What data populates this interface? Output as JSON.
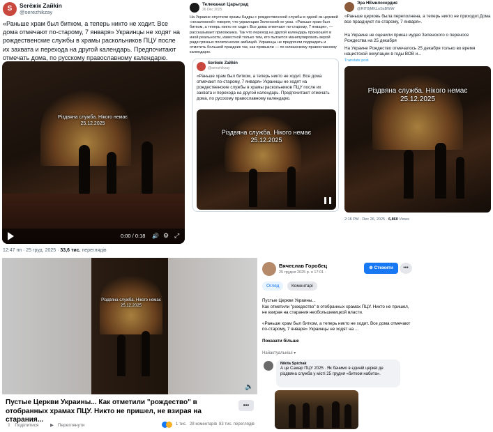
{
  "post1": {
    "avatar_initial": "S",
    "name": "Serёжік Zaйkin",
    "handle": "@serezhikzay",
    "text": "«Раньше храм был битком, а теперь никто не ходит. Все дома отмечают по-старому, 7 января» Украинцы не ходят на рождественские службы в храмы раскольников ПЦУ после их захвата и перехода на другой календарь. Предпочитают отмечать дома, по русскому православному календарю.",
    "video_caption_line1": "Різдвяна служба. Нікого немає",
    "video_caption_line2": "25.12.2025",
    "time": "0:00 / 0:18",
    "footer": "12:47 пп · 25 груд. 2025 ·",
    "views": "33,6 тис.",
    "views_label": "переглядів"
  },
  "post2": {
    "name": "Телеканал Царьград",
    "date": "26 Dec 2025",
    "text": "На Украине опустели храмы Кадры с рождественской службы в одной из церквей «незалежной» говорят, что украинцам Зеленский не указ. «Раньше храм был битком, а теперь никто не ходит. Все дома отмечают по-старому, 7 января», — рассказывает прихожанка. Так что переход на другой календарь произошёл в иной реальности, известной только тем, кто пытается манипулировать верой ради грязных политических амбиций. Украинцы не предпочли подождать и отметить большой праздник так, как привыкли — по юлианскому православному календарю.",
    "quote_name": "Serёжік Zaйkin",
    "quote_handle": "@serezhikzay",
    "quote_text": "«Раньше храм был битком, а теперь никто не ходит. Все дома отмечают по-старому, 7 января» Украинцы не ходят на рождественские службы в храмы раскольников ПЦУ после их захвата и перехода на другой календарь. Предпочитают отмечать дома, по русскому православному календарю.",
    "caption_line1": "Різдвяна служба. Нікого немає",
    "caption_line2": "25.12.2025"
  },
  "post3": {
    "name": "Эра НЕмилосердия",
    "handle": "@RIT8jMKLoSsBWW",
    "text1": "«Раньше церковь была переполнена, а теперь никто не приходит.Дома все празднуют по-старому, 7 января».",
    "text2": "На Украине не оценили приказ иудея Зеленского о переносе Рождества на 25 декабря",
    "text3": "На Украине Рождество отмечалось 25 декабря только во время нацистской оккупации в годы ВОВ и...",
    "translate": "Translate post",
    "caption_line1": "Різдвяна служба. Нікого немає",
    "caption_line2": "25.12.2025",
    "footer": "2:16 PM · Dec 26, 2025 ·",
    "views": "6,860",
    "views_label": "Views"
  },
  "post4": {
    "caption_line1": "Різдвяна служба. Нікого немає",
    "caption_line2": "25.12.2025",
    "title": "Пустые Церкви Украины... Как отметили \"рождество\" в отобранных храмах ПЦУ. Никто не пришел, не взирая на старания...",
    "more": "•••",
    "share_label": "Поділитися",
    "views_label": "Переглянути",
    "reactions": "1 тис.",
    "comments": "28 коментарів",
    "views": "83 тис. переглядів"
  },
  "post5": {
    "name": "Вячеслав Горобец",
    "date": "25 грудня 2025 р. о 17:01 ·",
    "follow": "Стежити",
    "tab1": "Огляд",
    "tab2": "Коментарі",
    "body_line1": "Пустые Церкви Украины...",
    "body_line2": "Как отметили \"рождество\" в отобранных храмах ПЦУ. Никто не пришел, не взирая на старания необольшевицкой власти.",
    "body_quote": "«Раньше храм был битком, а теперь никто не ходит. Все дома отмечают по-старому, 7 января» Украинцы не ходят на ...",
    "show_more": "Показати більше",
    "sort_label": "Найактуальніші",
    "commenter": "Nikita Spichak",
    "comment": "А це Самар ПЦУ 2025 . Як бачимо в єдиній церкві де різдвяна служба у місті 25 грудня «битком набита»."
  }
}
